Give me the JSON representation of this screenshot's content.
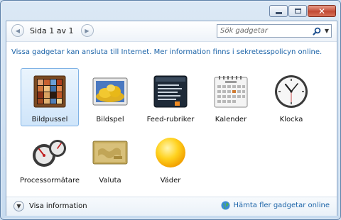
{
  "window": {
    "controls": {
      "minimize_icon": "minimize-icon",
      "maximize_icon": "maximize-icon",
      "close_icon": "close-icon"
    }
  },
  "toolbar": {
    "page_label": "Sida 1 av 1",
    "search_placeholder": "Sök gadgetar",
    "prev_icon": "chevron-left-icon",
    "next_icon": "chevron-right-icon",
    "search_icon": "search-icon",
    "dropdown_icon": "dropdown-arrow-icon"
  },
  "info_text": "Vissa gadgetar kan ansluta till Internet. Mer information finns i sekretesspolicyn online.",
  "gadgets": [
    {
      "label": "Bildpussel",
      "icon": "picture-puzzle-icon",
      "selected": true
    },
    {
      "label": "Bildspel",
      "icon": "slideshow-icon",
      "selected": false
    },
    {
      "label": "Feed-rubriker",
      "icon": "feed-headlines-icon",
      "selected": false
    },
    {
      "label": "Kalender",
      "icon": "calendar-icon",
      "selected": false
    },
    {
      "label": "Klocka",
      "icon": "clock-icon",
      "selected": false
    },
    {
      "label": "Processormätare",
      "icon": "cpu-meter-icon",
      "selected": false
    },
    {
      "label": "Valuta",
      "icon": "currency-icon",
      "selected": false
    },
    {
      "label": "Väder",
      "icon": "weather-icon",
      "selected": false
    }
  ],
  "footer": {
    "show_details": "Visa information",
    "get_more": "Hämta fler gadgetar online"
  },
  "colors": {
    "link": "#1b63a8",
    "selection": "#cfe5fa",
    "close_button": "#c24a35"
  }
}
